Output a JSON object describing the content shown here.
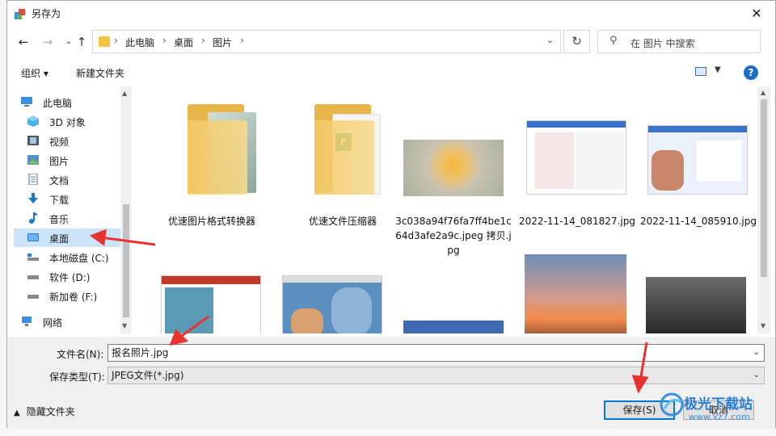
{
  "dialog": {
    "title": "另存为",
    "close_label": "✕"
  },
  "address": {
    "segments": [
      "此电脑",
      "桌面",
      "图片"
    ],
    "search_placeholder": "在 图片 中搜索"
  },
  "toolbar": {
    "organize_label": "组织 ▾",
    "new_folder_label": "新建文件夹",
    "help_label": "?"
  },
  "nav": {
    "items": [
      {
        "label": "此电脑",
        "icon": "pc-icon"
      },
      {
        "label": "3D 对象",
        "icon": "3d-objects-icon"
      },
      {
        "label": "视频",
        "icon": "video-icon"
      },
      {
        "label": "图片",
        "icon": "pictures-icon"
      },
      {
        "label": "文档",
        "icon": "documents-icon"
      },
      {
        "label": "下载",
        "icon": "download-icon"
      },
      {
        "label": "音乐",
        "icon": "music-icon"
      },
      {
        "label": "桌面",
        "icon": "desktop-icon"
      },
      {
        "label": "本地磁盘 (C:)",
        "icon": "drive-icon"
      },
      {
        "label": "软件 (D:)",
        "icon": "drive-icon"
      },
      {
        "label": "新加卷 (F:)",
        "icon": "drive-icon"
      },
      {
        "label": "网络",
        "icon": "network-icon"
      }
    ],
    "selected": "桌面"
  },
  "files": [
    {
      "name": "优速图片格式转换器",
      "kind": "folder"
    },
    {
      "name": "优速文件压缩器",
      "kind": "folder"
    },
    {
      "name": "3c038a94f76fa7ff4be1c64d3afe2a9c.jpeg 拷贝.jpg",
      "kind": "image"
    },
    {
      "name": "2022-11-14_081827.jpg",
      "kind": "image"
    },
    {
      "name": "2022-11-14_085910.jpg",
      "kind": "image"
    },
    {
      "name": "",
      "kind": "image"
    },
    {
      "name": "",
      "kind": "image"
    },
    {
      "name": "",
      "kind": "image"
    },
    {
      "name": "",
      "kind": "image"
    },
    {
      "name": "",
      "kind": "image"
    }
  ],
  "form": {
    "filename_label": "文件名(N):",
    "filename_value": "报名照片.jpg",
    "filetype_label": "保存类型(T):",
    "filetype_value": "JPEG文件(*.jpg)",
    "hide_folders_label": "隐藏文件夹",
    "save_label": "保存(S)",
    "cancel_label": "取消"
  },
  "watermark": {
    "text": "极光下载站",
    "url": "www.xz7.com"
  },
  "colors": {
    "accent": "#0078d7",
    "selected_bg": "#cce4f7",
    "arrow_red": "#e8322f",
    "folder": "#f4c542"
  }
}
